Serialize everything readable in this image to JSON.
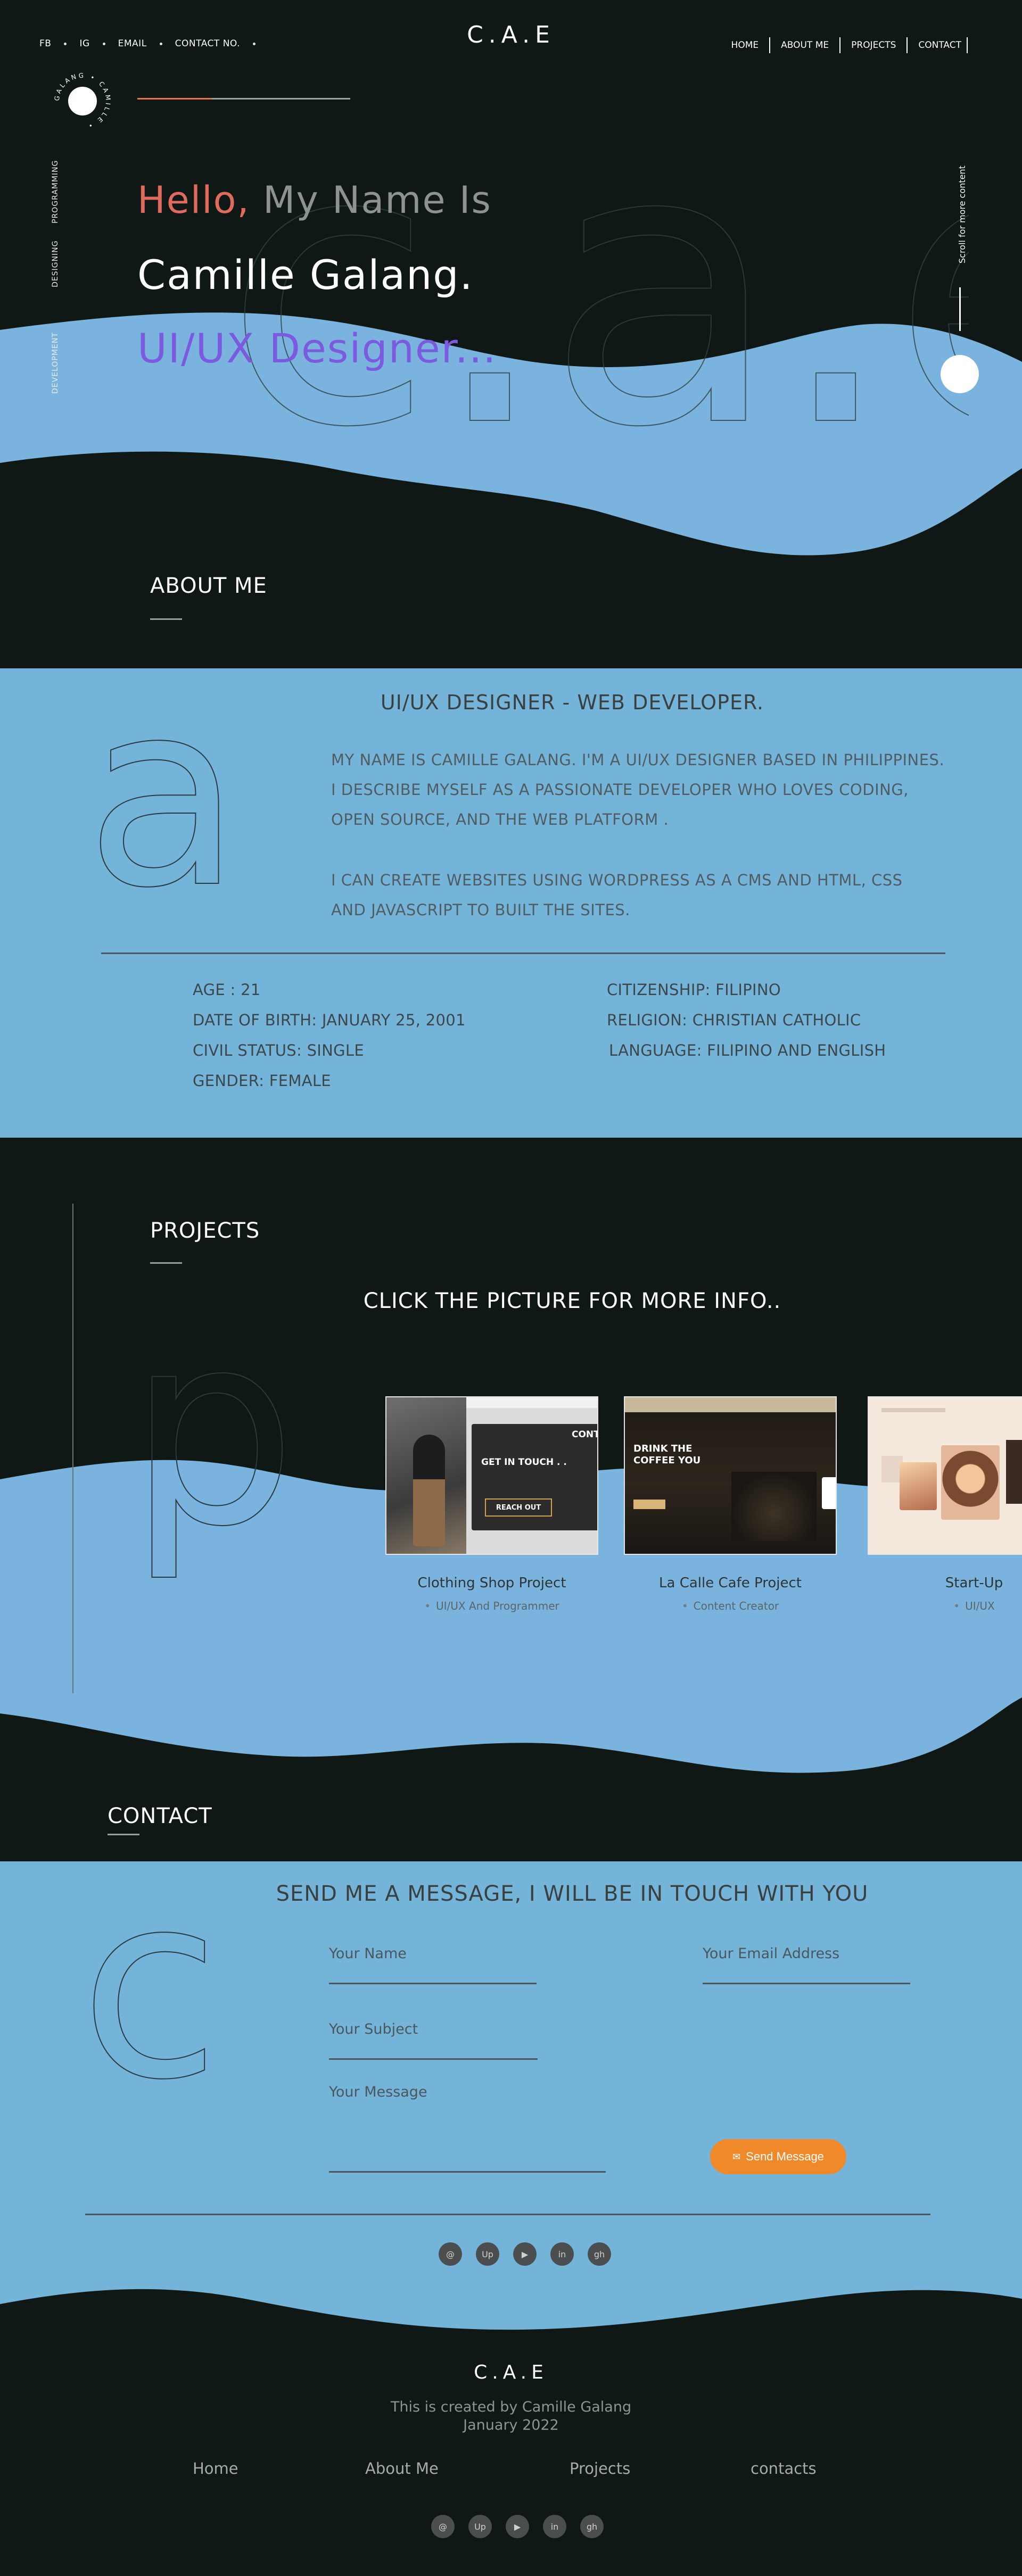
{
  "header": {
    "left_links": [
      "FB",
      "IG",
      "EMAIL",
      "CONTACT NO."
    ],
    "brand": "C.A.E",
    "nav": [
      "HOME",
      "ABOUT ME",
      "PROJECTS",
      "CONTACT"
    ],
    "badge_text": "GALANG • CAMILLE •"
  },
  "hero": {
    "hello": "Hello,",
    "my_name_is": "My Name Is",
    "name": "Camille Galang.",
    "role": "UI/UX Designer...",
    "side_labels": [
      "PROGRAMMING",
      "DESIGNING",
      "DEVELOPMENT"
    ],
    "scroll_text": "Scroll for more content",
    "bg_letters": "c.a.e"
  },
  "about": {
    "section_title": "ABOUT ME",
    "heading": "UI/UX DESIGNER - WEB DEVELOPER.",
    "big_letter": "a",
    "paragraph1": [
      "MY NAME IS CAMILLE GALANG. I'M A UI/UX DESIGNER BASED IN PHILIPPINES.",
      "I DESCRIBE MYSELF AS A PASSIONATE DEVELOPER WHO LOVES CODING,",
      "OPEN SOURCE, AND THE WEB PLATFORM ."
    ],
    "paragraph2": [
      "I CAN CREATE WEBSITES USING WORDPRESS AS A CMS AND HTML, CSS",
      "AND JAVASCRIPT TO BUILT THE SITES."
    ],
    "info_left": [
      "AGE : 21",
      "DATE OF BIRTH: JANUARY 25, 2001",
      "CIVIL STATUS: SINGLE",
      "GENDER: FEMALE"
    ],
    "info_right": [
      "CITIZENSHIP: FILIPINO",
      "RELIGION: CHRISTIAN CATHOLIC",
      "LANGUAGE: FILIPINO AND ENGLISH"
    ]
  },
  "projects": {
    "section_title": "PROJECTS",
    "instruction": "CLICK THE PICTURE FOR MORE INFO..",
    "big_letter": "p",
    "cards": [
      {
        "title": "Clothing Shop Project",
        "subtitle": "UI/UX And Programmer",
        "thumb_heading": "GET IN TOUCH . .",
        "thumb_button": "REACH OUT",
        "thumb_corner": "CONT"
      },
      {
        "title": "La Calle Cafe Project",
        "subtitle": "Content Creator",
        "thumb_heading": "DRINK THE COFFEE YOU"
      },
      {
        "title": "Start-Up",
        "subtitle": "UI/UX"
      }
    ]
  },
  "contact": {
    "section_title": "CONTACT",
    "heading": "SEND ME A MESSAGE, I WILL BE IN TOUCH WITH YOU",
    "big_letter": "c",
    "fields": {
      "name": "Your Name",
      "email": "Your Email Address",
      "subject": "Your Subject",
      "message": "Your Message"
    },
    "send_label": "Send Message",
    "socials": [
      "@",
      "Up",
      "▶",
      "in",
      "gh"
    ]
  },
  "footer": {
    "brand": "C.A.E",
    "credit": "This is created by Camille Galang",
    "date": "January 2022",
    "nav": [
      "Home",
      "About Me",
      "Projects",
      "contacts"
    ]
  },
  "colors": {
    "background": "#0f1814",
    "accent_blue": "#74b4d9",
    "hello": "#e16a5e",
    "role": "#7b5ae0",
    "button": "#f0892a"
  }
}
